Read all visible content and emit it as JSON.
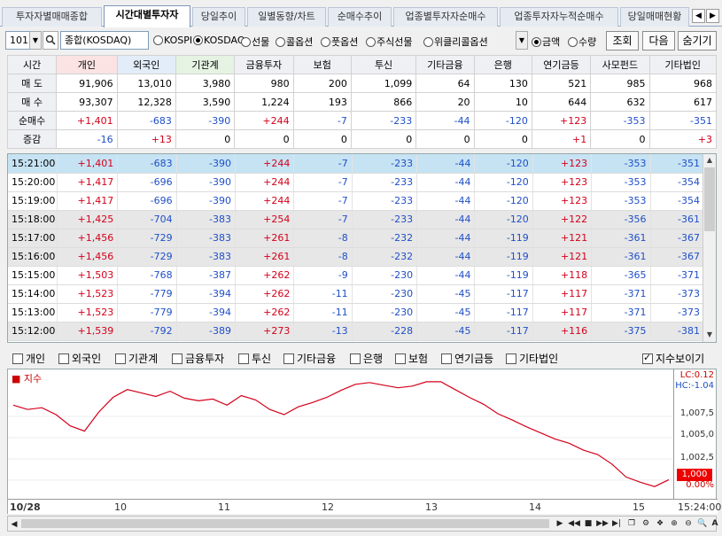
{
  "tabs": [
    {
      "label": "투자자별매매종합"
    },
    {
      "label": "시간대별투자자"
    },
    {
      "label": "당일추이"
    },
    {
      "label": "일별동향/차트"
    },
    {
      "label": "순매수추이"
    },
    {
      "label": "업종별투자자순매수"
    },
    {
      "label": "업종투자자누적순매수"
    },
    {
      "label": "당일매매현황"
    }
  ],
  "toolbar": {
    "code": "101",
    "index_name": "종합(KOSDAQ)",
    "markets": [
      "KOSPI",
      "KOSDAQ",
      "선물",
      "콜옵션",
      "풋옵션",
      "주식선물",
      "위클리콜옵션"
    ],
    "selected_market": "KOSDAQ",
    "units": [
      "금액",
      "수량"
    ],
    "selected_unit": "금액",
    "query_label": "조회",
    "next_label": "다음",
    "hide_label": "숨기기"
  },
  "summary": {
    "columns": [
      "시간",
      "개인",
      "외국인",
      "기관계",
      "금융투자",
      "보험",
      "투신",
      "기타금융",
      "은행",
      "연기금등",
      "사모펀드",
      "기타법인"
    ],
    "rows": [
      {
        "label": "매 도",
        "values": [
          "91,906",
          "13,010",
          "3,980",
          "980",
          "200",
          "1,099",
          "64",
          "130",
          "521",
          "985",
          "968"
        ]
      },
      {
        "label": "매 수",
        "values": [
          "93,307",
          "12,328",
          "3,590",
          "1,224",
          "193",
          "866",
          "20",
          "10",
          "644",
          "632",
          "617"
        ]
      },
      {
        "label": "순매수",
        "values": [
          "+1,401",
          "-683",
          "-390",
          "+244",
          "-7",
          "-233",
          "-44",
          "-120",
          "+123",
          "-353",
          "-351"
        ]
      },
      {
        "label": "증감",
        "values": [
          "-16",
          "+13",
          "0",
          "0",
          "0",
          "0",
          "0",
          "0",
          "+1",
          "0",
          "+3"
        ]
      }
    ]
  },
  "time_rows": [
    {
      "time": "15:21:00",
      "values": [
        "+1,401",
        "-683",
        "-390",
        "+244",
        "-7",
        "-233",
        "-44",
        "-120",
        "+123",
        "-353",
        "-351"
      ]
    },
    {
      "time": "15:20:00",
      "values": [
        "+1,417",
        "-696",
        "-390",
        "+244",
        "-7",
        "-233",
        "-44",
        "-120",
        "+123",
        "-353",
        "-354"
      ]
    },
    {
      "time": "15:19:00",
      "values": [
        "+1,417",
        "-696",
        "-390",
        "+244",
        "-7",
        "-233",
        "-44",
        "-120",
        "+123",
        "-353",
        "-354"
      ]
    },
    {
      "time": "15:18:00",
      "values": [
        "+1,425",
        "-704",
        "-383",
        "+254",
        "-7",
        "-233",
        "-44",
        "-120",
        "+122",
        "-356",
        "-361"
      ]
    },
    {
      "time": "15:17:00",
      "values": [
        "+1,456",
        "-729",
        "-383",
        "+261",
        "-8",
        "-232",
        "-44",
        "-119",
        "+121",
        "-361",
        "-367"
      ]
    },
    {
      "time": "15:16:00",
      "values": [
        "+1,456",
        "-729",
        "-383",
        "+261",
        "-8",
        "-232",
        "-44",
        "-119",
        "+121",
        "-361",
        "-367"
      ]
    },
    {
      "time": "15:15:00",
      "values": [
        "+1,503",
        "-768",
        "-387",
        "+262",
        "-9",
        "-230",
        "-44",
        "-119",
        "+118",
        "-365",
        "-371"
      ]
    },
    {
      "time": "15:14:00",
      "values": [
        "+1,523",
        "-779",
        "-394",
        "+262",
        "-11",
        "-230",
        "-45",
        "-117",
        "+117",
        "-371",
        "-373"
      ]
    },
    {
      "time": "15:13:00",
      "values": [
        "+1,523",
        "-779",
        "-394",
        "+262",
        "-11",
        "-230",
        "-45",
        "-117",
        "+117",
        "-371",
        "-373"
      ]
    },
    {
      "time": "15:12:00",
      "values": [
        "+1,539",
        "-792",
        "-389",
        "+273",
        "-13",
        "-228",
        "-45",
        "-117",
        "+116",
        "-375",
        "-381"
      ]
    }
  ],
  "filters": [
    {
      "label": "개인",
      "checked": false
    },
    {
      "label": "외국인",
      "checked": false
    },
    {
      "label": "기관계",
      "checked": false
    },
    {
      "label": "금융투자",
      "checked": false
    },
    {
      "label": "투신",
      "checked": false
    },
    {
      "label": "기타금융",
      "checked": false
    },
    {
      "label": "은행",
      "checked": false
    },
    {
      "label": "보험",
      "checked": false
    },
    {
      "label": "연기금등",
      "checked": false
    },
    {
      "label": "기타법인",
      "checked": false
    },
    {
      "label": "지수보이기",
      "checked": true
    }
  ],
  "chart_data": {
    "type": "line",
    "series": [
      {
        "name": "지수",
        "color": "#d4001a",
        "values": [
          1009.2,
          1008.7,
          1008.9,
          1008.1,
          1006.8,
          1006.2,
          1008.4,
          1010.1,
          1011.0,
          1010.6,
          1010.2,
          1010.8,
          1010.0,
          1009.7,
          1009.9,
          1009.2,
          1010.3,
          1009.8,
          1008.7,
          1008.1,
          1009.0,
          1009.5,
          1010.1,
          1010.9,
          1011.6,
          1011.8,
          1011.5,
          1011.2,
          1011.4,
          1011.9,
          1011.9,
          1011.0,
          1010.1,
          1009.3,
          1008.2,
          1007.5,
          1006.7,
          1006.0,
          1005.3,
          1004.8,
          1004.0,
          1003.5,
          1002.4,
          1000.9,
          1000.3,
          999.8,
          1000.6
        ]
      }
    ],
    "ytick_labels": [
      "1,007,5",
      "1,005,0",
      "1,002,5"
    ],
    "ylim": [
      999.0,
      1012.5
    ],
    "x_labels": [
      "10/28",
      "10",
      "11",
      "12",
      "13",
      "14",
      "15"
    ],
    "x_end_label": "15:24:00",
    "lc_label": "LC:0.12",
    "hc_label": "HC:-1.04",
    "current_label": "1,000",
    "current_pct": "0.00%"
  }
}
